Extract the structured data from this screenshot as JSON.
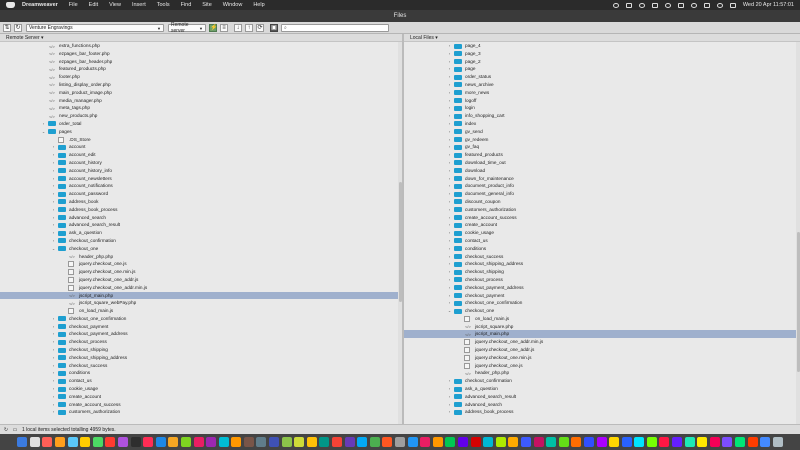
{
  "menubar": {
    "app_name": "Dreamweaver",
    "items": [
      "File",
      "Edit",
      "View",
      "Insert",
      "Tools",
      "Find",
      "Site",
      "Window",
      "Help"
    ],
    "clock": "Wed 20 Apr  11:57:01"
  },
  "window": {
    "title": "Files"
  },
  "toolbar": {
    "site_select": "Venture Engravings",
    "server_select": "Remote server",
    "search_placeholder": ""
  },
  "remote_pane": {
    "header": "Remote Server ▾",
    "rows": [
      {
        "label": "extra_functions.php",
        "indent": 0,
        "type": "code"
      },
      {
        "label": "ezpages_bar_footer.php",
        "indent": 0,
        "type": "code"
      },
      {
        "label": "ezpages_bar_header.php",
        "indent": 0,
        "type": "code"
      },
      {
        "label": "featured_products.php",
        "indent": 0,
        "type": "code"
      },
      {
        "label": "footer.php",
        "indent": 0,
        "type": "code"
      },
      {
        "label": "listing_display_order.php",
        "indent": 0,
        "type": "code"
      },
      {
        "label": "main_product_image.php",
        "indent": 0,
        "type": "code"
      },
      {
        "label": "media_manager.php",
        "indent": 0,
        "type": "code"
      },
      {
        "label": "meta_tags.php",
        "indent": 0,
        "type": "code"
      },
      {
        "label": "new_products.php",
        "indent": 0,
        "type": "code"
      },
      {
        "label": "order_total",
        "indent": 0,
        "type": "folder",
        "twisty": "›"
      },
      {
        "label": "pages",
        "indent": 0,
        "type": "folder",
        "twisty": "⌄"
      },
      {
        "label": ".DS_Store",
        "indent": 1,
        "type": "file"
      },
      {
        "label": "account",
        "indent": 1,
        "type": "folder",
        "twisty": "›"
      },
      {
        "label": "account_edit",
        "indent": 1,
        "type": "folder",
        "twisty": "›"
      },
      {
        "label": "account_history",
        "indent": 1,
        "type": "folder",
        "twisty": "›"
      },
      {
        "label": "account_history_info",
        "indent": 1,
        "type": "folder",
        "twisty": "›"
      },
      {
        "label": "account_newsletters",
        "indent": 1,
        "type": "folder",
        "twisty": "›"
      },
      {
        "label": "account_notifications",
        "indent": 1,
        "type": "folder",
        "twisty": "›"
      },
      {
        "label": "account_password",
        "indent": 1,
        "type": "folder",
        "twisty": "›"
      },
      {
        "label": "address_book",
        "indent": 1,
        "type": "folder",
        "twisty": "›"
      },
      {
        "label": "address_book_process",
        "indent": 1,
        "type": "folder",
        "twisty": "›"
      },
      {
        "label": "advanced_search",
        "indent": 1,
        "type": "folder",
        "twisty": "›"
      },
      {
        "label": "advanced_search_result",
        "indent": 1,
        "type": "folder",
        "twisty": "›"
      },
      {
        "label": "ask_a_question",
        "indent": 1,
        "type": "folder",
        "twisty": "›"
      },
      {
        "label": "checkout_confirmation",
        "indent": 1,
        "type": "folder",
        "twisty": "›"
      },
      {
        "label": "checkout_one",
        "indent": 1,
        "type": "folder",
        "twisty": "⌄"
      },
      {
        "label": "header_php.php",
        "indent": 2,
        "type": "code"
      },
      {
        "label": "jquery.checkout_one.js",
        "indent": 2,
        "type": "file"
      },
      {
        "label": "jquery.checkout_one.min.js",
        "indent": 2,
        "type": "file"
      },
      {
        "label": "jquery.checkout_one_addr.js",
        "indent": 2,
        "type": "file"
      },
      {
        "label": "jquery.checkout_one_addr.min.js",
        "indent": 2,
        "type": "file"
      },
      {
        "label": "jscript_main.php",
        "indent": 2,
        "type": "code",
        "selected": true
      },
      {
        "label": "jscript_square_webPay.php",
        "indent": 2,
        "type": "code"
      },
      {
        "label": "on_load_main.js",
        "indent": 2,
        "type": "file"
      },
      {
        "label": "checkout_one_confirmation",
        "indent": 1,
        "type": "folder",
        "twisty": "›"
      },
      {
        "label": "checkout_payment",
        "indent": 1,
        "type": "folder",
        "twisty": "›"
      },
      {
        "label": "checkout_payment_address",
        "indent": 1,
        "type": "folder",
        "twisty": "›"
      },
      {
        "label": "checkout_process",
        "indent": 1,
        "type": "folder",
        "twisty": "›"
      },
      {
        "label": "checkout_shipping",
        "indent": 1,
        "type": "folder",
        "twisty": "›"
      },
      {
        "label": "checkout_shipping_address",
        "indent": 1,
        "type": "folder",
        "twisty": "›"
      },
      {
        "label": "checkout_success",
        "indent": 1,
        "type": "folder",
        "twisty": "›"
      },
      {
        "label": "conditions",
        "indent": 1,
        "type": "folder",
        "twisty": "›"
      },
      {
        "label": "contact_us",
        "indent": 1,
        "type": "folder",
        "twisty": "›"
      },
      {
        "label": "cookie_usage",
        "indent": 1,
        "type": "folder",
        "twisty": "›"
      },
      {
        "label": "create_account",
        "indent": 1,
        "type": "folder",
        "twisty": "›"
      },
      {
        "label": "create_account_success",
        "indent": 1,
        "type": "folder",
        "twisty": "›"
      },
      {
        "label": "customers_authorization",
        "indent": 1,
        "type": "folder",
        "twisty": "›"
      }
    ]
  },
  "local_pane": {
    "header": "Local Files ▾",
    "rows": [
      {
        "label": "page_4",
        "indent": 0,
        "type": "folder",
        "twisty": "›"
      },
      {
        "label": "page_3",
        "indent": 0,
        "type": "folder",
        "twisty": "›"
      },
      {
        "label": "page_2",
        "indent": 0,
        "type": "folder",
        "twisty": "›"
      },
      {
        "label": "page",
        "indent": 0,
        "type": "folder",
        "twisty": "›"
      },
      {
        "label": "order_status",
        "indent": 0,
        "type": "folder",
        "twisty": "›"
      },
      {
        "label": "news_archive",
        "indent": 0,
        "type": "folder",
        "twisty": "›"
      },
      {
        "label": "more_news",
        "indent": 0,
        "type": "folder",
        "twisty": "›"
      },
      {
        "label": "logoff",
        "indent": 0,
        "type": "folder",
        "twisty": "›"
      },
      {
        "label": "login",
        "indent": 0,
        "type": "folder",
        "twisty": "›"
      },
      {
        "label": "info_shopping_cart",
        "indent": 0,
        "type": "folder",
        "twisty": "›"
      },
      {
        "label": "index",
        "indent": 0,
        "type": "folder",
        "twisty": "›"
      },
      {
        "label": "gv_send",
        "indent": 0,
        "type": "folder",
        "twisty": "›"
      },
      {
        "label": "gv_redeem",
        "indent": 0,
        "type": "folder",
        "twisty": "›"
      },
      {
        "label": "gv_faq",
        "indent": 0,
        "type": "folder",
        "twisty": "›"
      },
      {
        "label": "featured_products",
        "indent": 0,
        "type": "folder",
        "twisty": "›"
      },
      {
        "label": "download_time_out",
        "indent": 0,
        "type": "folder",
        "twisty": "›"
      },
      {
        "label": "download",
        "indent": 0,
        "type": "folder",
        "twisty": "›"
      },
      {
        "label": "down_for_maintenance",
        "indent": 0,
        "type": "folder",
        "twisty": "›"
      },
      {
        "label": "document_product_info",
        "indent": 0,
        "type": "folder",
        "twisty": "›"
      },
      {
        "label": "document_general_info",
        "indent": 0,
        "type": "folder",
        "twisty": "›"
      },
      {
        "label": "discount_coupon",
        "indent": 0,
        "type": "folder",
        "twisty": "›"
      },
      {
        "label": "customers_authorization",
        "indent": 0,
        "type": "folder",
        "twisty": "›"
      },
      {
        "label": "create_account_success",
        "indent": 0,
        "type": "folder",
        "twisty": "›"
      },
      {
        "label": "create_account",
        "indent": 0,
        "type": "folder",
        "twisty": "›"
      },
      {
        "label": "cookie_usage",
        "indent": 0,
        "type": "folder",
        "twisty": "›"
      },
      {
        "label": "contact_us",
        "indent": 0,
        "type": "folder",
        "twisty": "›"
      },
      {
        "label": "conditions",
        "indent": 0,
        "type": "folder",
        "twisty": "›"
      },
      {
        "label": "checkout_success",
        "indent": 0,
        "type": "folder",
        "twisty": "›"
      },
      {
        "label": "checkout_shipping_address",
        "indent": 0,
        "type": "folder",
        "twisty": "›"
      },
      {
        "label": "checkout_shipping",
        "indent": 0,
        "type": "folder",
        "twisty": "›"
      },
      {
        "label": "checkout_process",
        "indent": 0,
        "type": "folder",
        "twisty": "›"
      },
      {
        "label": "checkout_payment_address",
        "indent": 0,
        "type": "folder",
        "twisty": "›"
      },
      {
        "label": "checkout_payment",
        "indent": 0,
        "type": "folder",
        "twisty": "›"
      },
      {
        "label": "checkout_one_confirmation",
        "indent": 0,
        "type": "folder",
        "twisty": "›"
      },
      {
        "label": "checkout_one",
        "indent": 0,
        "type": "folder",
        "twisty": "⌄"
      },
      {
        "label": "on_load_main.js",
        "indent": 1,
        "type": "file"
      },
      {
        "label": "jscript_square.php",
        "indent": 1,
        "type": "code"
      },
      {
        "label": "jscript_main.php",
        "indent": 1,
        "type": "code",
        "selected": true
      },
      {
        "label": "jquery.checkout_one_addr.min.js",
        "indent": 1,
        "type": "file"
      },
      {
        "label": "jquery.checkout_one_addr.js",
        "indent": 1,
        "type": "file"
      },
      {
        "label": "jquery.checkout_one.min.js",
        "indent": 1,
        "type": "file"
      },
      {
        "label": "jquery.checkout_one.js",
        "indent": 1,
        "type": "file"
      },
      {
        "label": "header_php.php",
        "indent": 1,
        "type": "code"
      },
      {
        "label": "checkout_confirmation",
        "indent": 0,
        "type": "folder",
        "twisty": "›"
      },
      {
        "label": "ask_a_question",
        "indent": 0,
        "type": "folder",
        "twisty": "›"
      },
      {
        "label": "advanced_search_result",
        "indent": 0,
        "type": "folder",
        "twisty": "›"
      },
      {
        "label": "advanced_search",
        "indent": 0,
        "type": "folder",
        "twisty": "›"
      },
      {
        "label": "address_book_process",
        "indent": 0,
        "type": "folder",
        "twisty": "›"
      }
    ]
  },
  "statusbar": {
    "message": "1 local items selected totalling 4959 bytes."
  },
  "dock_colors": [
    "#3b7be0",
    "#e0e0e0",
    "#ff5f57",
    "#ff9f1c",
    "#5ac8fa",
    "#ffcc00",
    "#4cd964",
    "#ff3b30",
    "#af52de",
    "#2e2e2e",
    "#ff2d55",
    "#1e88e5",
    "#f5a623",
    "#7ed321",
    "#e91e63",
    "#9c27b0",
    "#00bcd4",
    "#ff9800",
    "#795548",
    "#607d8b",
    "#3f51b5",
    "#8bc34a",
    "#cddc39",
    "#ffc107",
    "#009688",
    "#f44336",
    "#673ab7",
    "#03a9f4",
    "#4caf50",
    "#ff5722",
    "#9e9e9e",
    "#2196f3",
    "#e91e63",
    "#ff9800",
    "#00c853",
    "#6200ea",
    "#d50000",
    "#00b8d4",
    "#aeea00",
    "#ffab00",
    "#3d5afe",
    "#c51162",
    "#00bfa5",
    "#64dd17",
    "#ff6d00",
    "#304ffe",
    "#aa00ff",
    "#ffd600",
    "#2962ff",
    "#00e5ff",
    "#76ff03",
    "#ff1744",
    "#651fff",
    "#1de9b6",
    "#ffea00",
    "#f50057",
    "#7c4dff",
    "#00e676",
    "#ff3d00",
    "#448aff",
    "#b0bec5"
  ]
}
